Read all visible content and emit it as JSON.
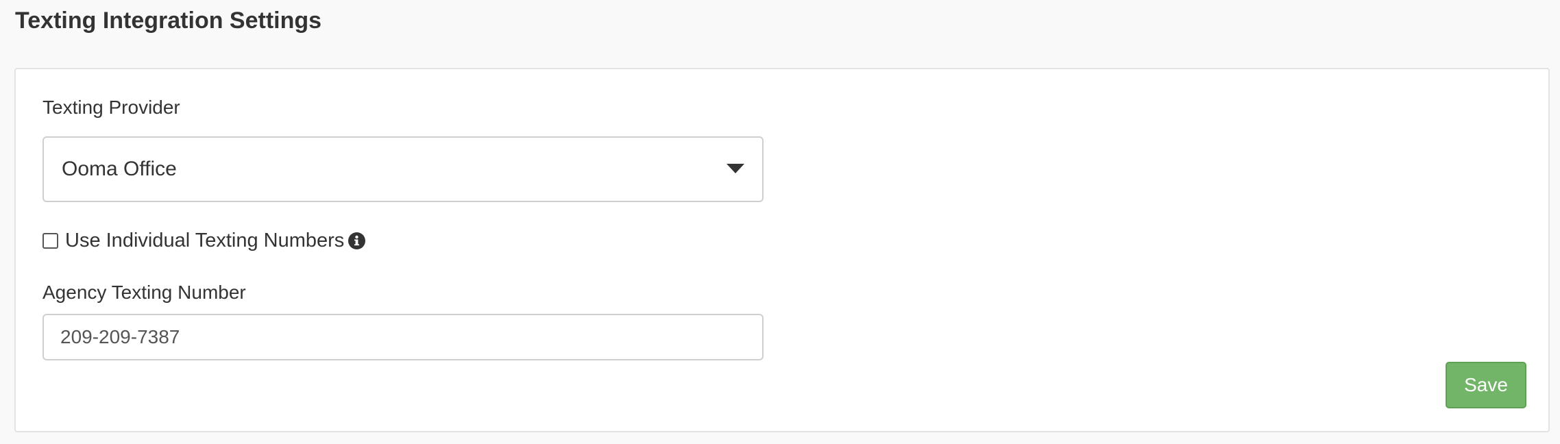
{
  "page": {
    "title": "Texting Integration Settings"
  },
  "form": {
    "provider_label": "Texting Provider",
    "provider_value": "Ooma Office",
    "individual_numbers_label": "Use Individual Texting Numbers",
    "individual_numbers_checked": false,
    "agency_number_label": "Agency Texting Number",
    "agency_number_value": "209-209-7387",
    "save_label": "Save"
  },
  "icons": {
    "dropdown": "caret-down-icon",
    "info": "info-circle-icon"
  },
  "colors": {
    "save_button": "#72b468",
    "text": "#333333",
    "page_background": "#f9f9f9"
  }
}
